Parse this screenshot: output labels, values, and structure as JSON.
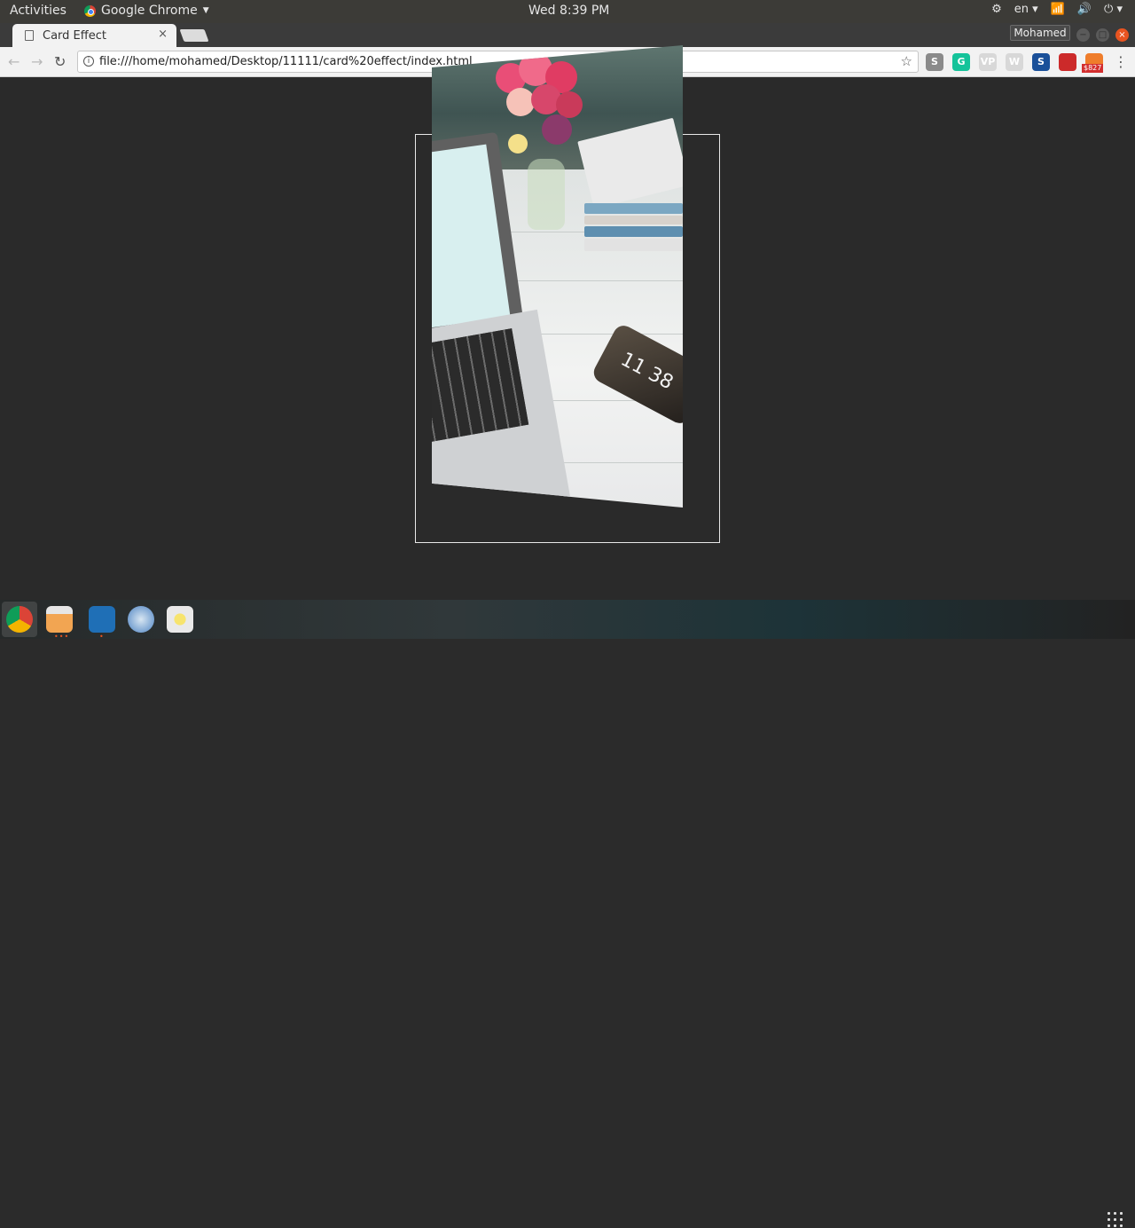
{
  "topbar": {
    "activities": "Activities",
    "app_name": "Google Chrome",
    "clock": "Wed  8:39 PM",
    "language": "en"
  },
  "browser": {
    "tab_title": "Card Effect",
    "tab_close": "×",
    "profile_name": "Mohamed",
    "url": "file:///home/mohamed/Desktop/11111/card%20effect/index.html",
    "extensions": [
      {
        "name": "s-icon",
        "label": "S",
        "color": "#8a8a8a"
      },
      {
        "name": "grammarly-icon",
        "label": "G",
        "color": "#15c39a"
      },
      {
        "name": "vp-icon",
        "label": "VP",
        "color": "#d8d8d8"
      },
      {
        "name": "wordpress-icon",
        "label": "W",
        "color": "#d8d8d8"
      },
      {
        "name": "steem-icon",
        "label": "S",
        "color": "#1a5099"
      },
      {
        "name": "italy-flag-icon",
        "label": "",
        "color": "#cc2a2a"
      },
      {
        "name": "orange-ext-icon",
        "label": "",
        "color": "#ef7d2b",
        "badge": "$827"
      }
    ]
  },
  "page": {
    "time_on_phone": "11 38"
  },
  "dock": {
    "apps": [
      "chrome",
      "files",
      "vscode",
      "safari-compass",
      "rhythmbox"
    ]
  }
}
